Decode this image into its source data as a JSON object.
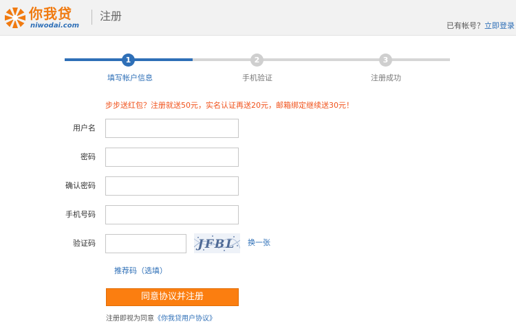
{
  "header": {
    "logo_cn": "你我贷",
    "logo_en": "niwodai.com",
    "title": "注册",
    "login_prompt": "已有帐号？",
    "login_link": "立即登录"
  },
  "steps": [
    {
      "number": "1",
      "label": "填写帐户信息",
      "state": "active"
    },
    {
      "number": "2",
      "label": "手机验证",
      "state": "inactive"
    },
    {
      "number": "3",
      "label": "注册成功",
      "state": "inactive"
    }
  ],
  "promo": "步步送红包？注册就送50元，实名认证再送20元，邮箱绑定继续送30元！",
  "form": {
    "username_label": "用户名",
    "username_value": "",
    "password_label": "密码",
    "password_value": "",
    "confirm_label": "确认密码",
    "confirm_value": "",
    "phone_label": "手机号码",
    "phone_value": "",
    "captcha_label": "验证码",
    "captcha_value": "",
    "captcha_text": "JFBL",
    "refresh_label": "换一张",
    "referral_label": "推荐码（选填）",
    "submit_label": "同意协议并注册"
  },
  "agreement": {
    "prefix": "注册即视为同意",
    "link": "《你我贷用户协议》"
  },
  "colors": {
    "brand_orange": "#f07a10",
    "brand_blue": "#2e6fb7",
    "button_orange": "#fb7e10",
    "promo_red": "#f0511a"
  }
}
